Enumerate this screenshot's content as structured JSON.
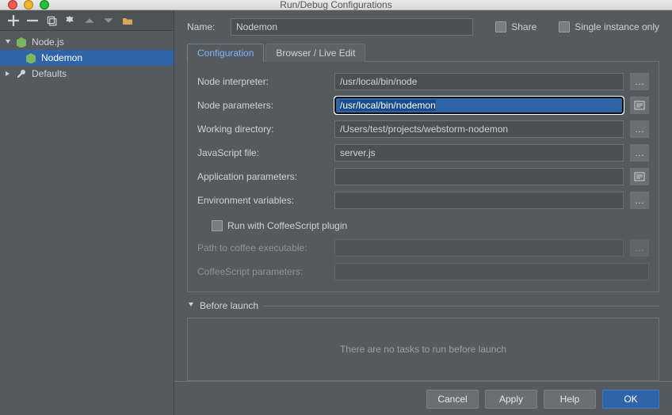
{
  "window": {
    "title": "Run/Debug Configurations"
  },
  "left": {
    "nodejs_label": "Node.js",
    "config_label": "Nodemon",
    "defaults_label": "Defaults"
  },
  "form": {
    "name_label": "Name:",
    "name_value": "Nodemon",
    "share_label": "Share",
    "single_instance_label": "Single instance only",
    "tabs": {
      "config": "Configuration",
      "browser": "Browser / Live Edit"
    },
    "rows": {
      "interpreter_label": "Node interpreter:",
      "interpreter_value": "/usr/local/bin/node",
      "params_label": "Node parameters:",
      "params_value": "/usr/local/bin/nodemon",
      "working_label": "Working directory:",
      "working_value": "/Users/test/projects/webstorm-nodemon",
      "jsfile_label": "JavaScript file:",
      "jsfile_value": "server.js",
      "appparams_label": "Application parameters:",
      "appparams_value": "",
      "env_label": "Environment variables:",
      "env_value": ""
    },
    "coffee": {
      "run_label": "Run with CoffeeScript plugin",
      "path_label": "Path to coffee executable:",
      "path_value": "",
      "params_label": "CoffeeScript parameters:",
      "params_value": ""
    }
  },
  "before_launch": {
    "title": "Before launch",
    "empty_text": "There are no tasks to run before launch"
  },
  "footer": {
    "cancel": "Cancel",
    "apply": "Apply",
    "help": "Help",
    "ok": "OK"
  },
  "colors": {
    "accent": "#2f65a8"
  }
}
